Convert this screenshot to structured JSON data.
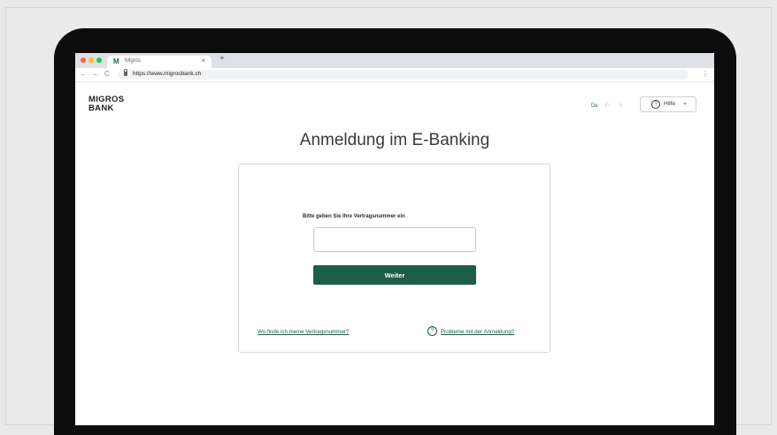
{
  "browser": {
    "tab_title": "Migros",
    "tab_favicon": "M",
    "tab_close": "×",
    "new_tab": "+",
    "url": "https://www.migrosbank.ch",
    "nav_back": "←",
    "nav_forward": "→",
    "nav_reload": "C",
    "menu": "⋮"
  },
  "header": {
    "logo_line1": "MIGROS",
    "logo_line2": "BANK",
    "languages": [
      "De",
      "Fr",
      "It"
    ],
    "active_language": "De",
    "help_label": "Hilfe",
    "help_icon": "?",
    "help_chevron": "⌄"
  },
  "main": {
    "title": "Anmeldung im E-Banking",
    "field_label": "Bitte geben Sie Ihre Vertragsnummer ein",
    "input_value": "",
    "next_button": "Weiter",
    "link_contract_number": "Wo finde ich meine Vertragsnummer?",
    "problems_icon": "?",
    "link_problems": "Probleme mit der Anmeldung?"
  },
  "colors": {
    "brand_green": "#1d5e48",
    "laptop_bezel": "#0d0d0d",
    "background": "#e9e9e9"
  }
}
